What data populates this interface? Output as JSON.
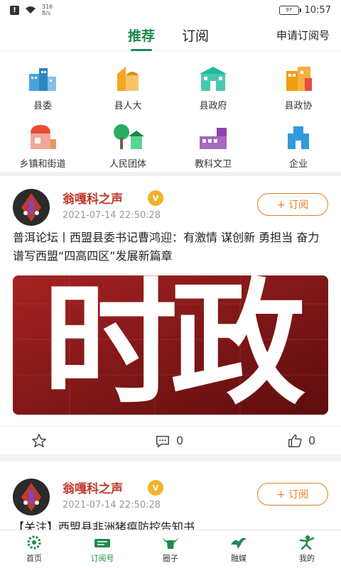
{
  "status": {
    "network_speed": "316\nB/s",
    "battery": "97",
    "time": "10:57"
  },
  "nav": {
    "tab_recommend": "推荐",
    "tab_subscribe": "订阅",
    "apply": "申请订阅号"
  },
  "categories": [
    {
      "label": "县委",
      "icon": "city-building-icon"
    },
    {
      "label": "县人大",
      "icon": "hall-building-icon"
    },
    {
      "label": "县政府",
      "icon": "government-building-icon"
    },
    {
      "label": "县政协",
      "icon": "office-building-icon"
    },
    {
      "label": "乡镇和街道",
      "icon": "shop-icon"
    },
    {
      "label": "人民团体",
      "icon": "park-pavilion-icon"
    },
    {
      "label": "教科文卫",
      "icon": "school-icon"
    },
    {
      "label": "企业",
      "icon": "tower-building-icon"
    }
  ],
  "posts": [
    {
      "author": "翁嘎科之声",
      "badge": "V",
      "time": "2021-07-14 22:50:28",
      "subscribe": "+ 订阅",
      "headline": "普洱论坛丨西盟县委书记曹鸿迎：有激情 谋创新 勇担当 奋力谱写西盟“四高四区”发展新篇章",
      "cover_text": "时政",
      "comments": "0",
      "likes": "0"
    },
    {
      "author": "翁嘎科之声",
      "badge": "V",
      "time": "2021-07-14 22:50:28",
      "subscribe": "+ 订阅",
      "headline": "【关注】西盟县非洲猪瘟防控告知书"
    }
  ],
  "tabbar": [
    {
      "label": "首页",
      "icon": "home-gear-icon"
    },
    {
      "label": "订阅号",
      "icon": "subscription-icon"
    },
    {
      "label": "圈子",
      "icon": "buffalo-icon"
    },
    {
      "label": "融媒",
      "icon": "bird-icon"
    },
    {
      "label": "我的",
      "icon": "dancer-icon"
    }
  ],
  "colors": {
    "accent": "#1f8a4c",
    "author": "#c0392b",
    "subscribe": "#e67e22",
    "cover": "#8c1a1a"
  }
}
